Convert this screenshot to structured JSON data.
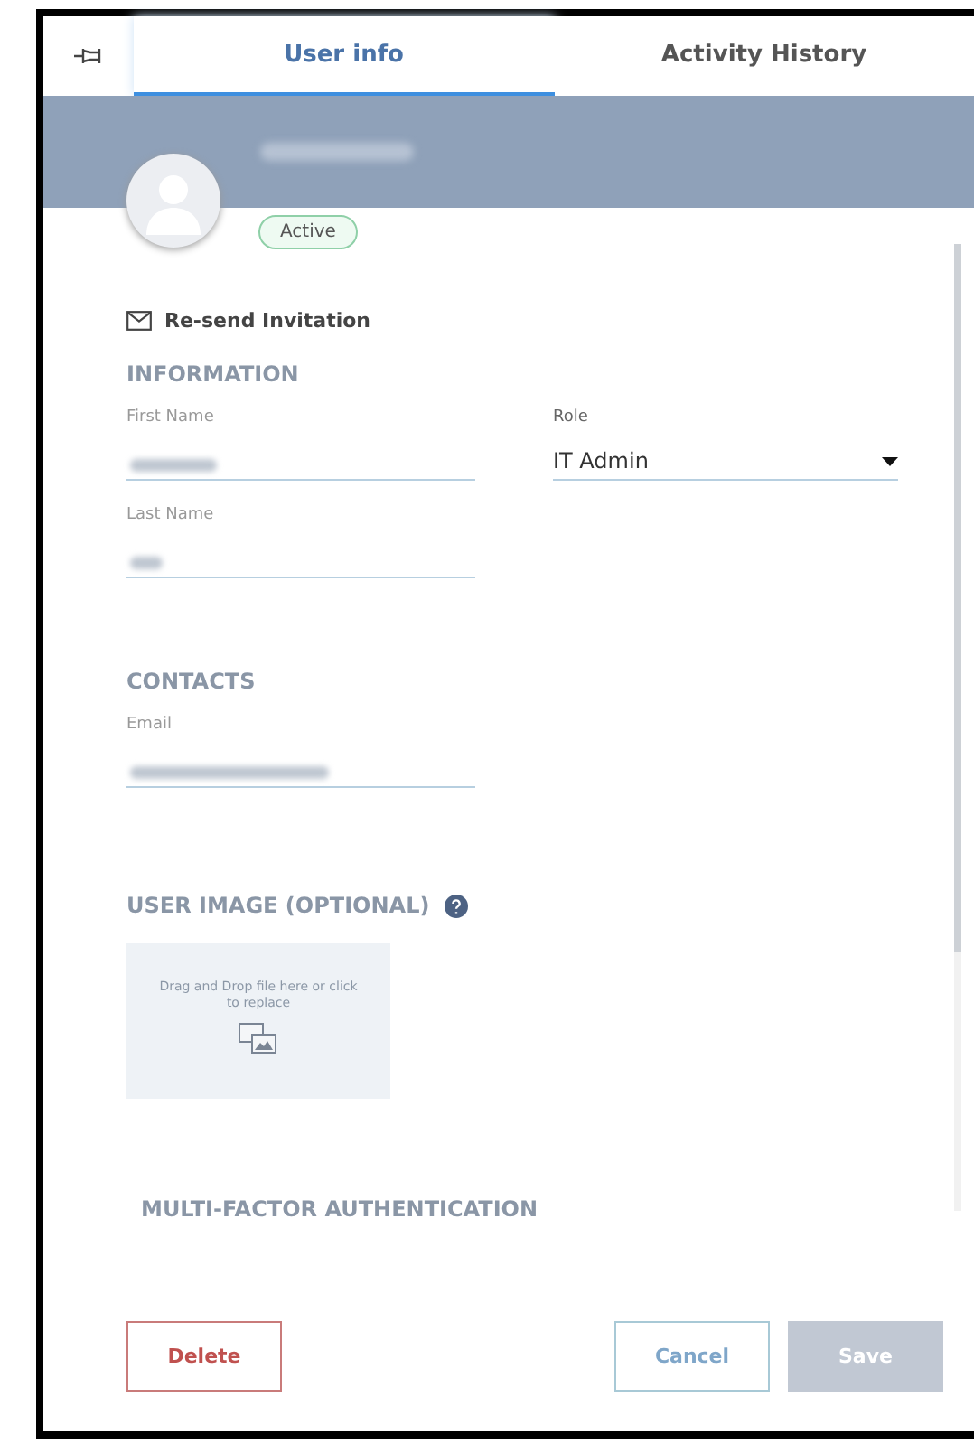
{
  "tabs": [
    {
      "label": "User info",
      "selected": true
    },
    {
      "label": "Activity History",
      "selected": false
    }
  ],
  "profile": {
    "status": "Active"
  },
  "resend_link": "Re-send Invitation",
  "information": {
    "title": "INFORMATION",
    "fields": [
      {
        "label": "First Name"
      },
      {
        "label": "Last Name"
      }
    ],
    "role": {
      "label": "Role",
      "value": "IT Admin"
    }
  },
  "contacts": {
    "title": "CONTACTS",
    "fields": [
      {
        "label": "Email"
      }
    ]
  },
  "user_image": {
    "title": "USER IMAGE (OPTIONAL)",
    "dropzone_text": "Drag and Drop file here or click to replace"
  },
  "mfa": {
    "title": "MULTI-FACTOR AUTHENTICATION"
  },
  "buttons": [
    {
      "label": "Delete",
      "kind": "danger",
      "disabled": false
    },
    {
      "label": "Cancel",
      "kind": "secondary",
      "disabled": false
    },
    {
      "label": "Save",
      "kind": "primary",
      "disabled": true
    }
  ]
}
